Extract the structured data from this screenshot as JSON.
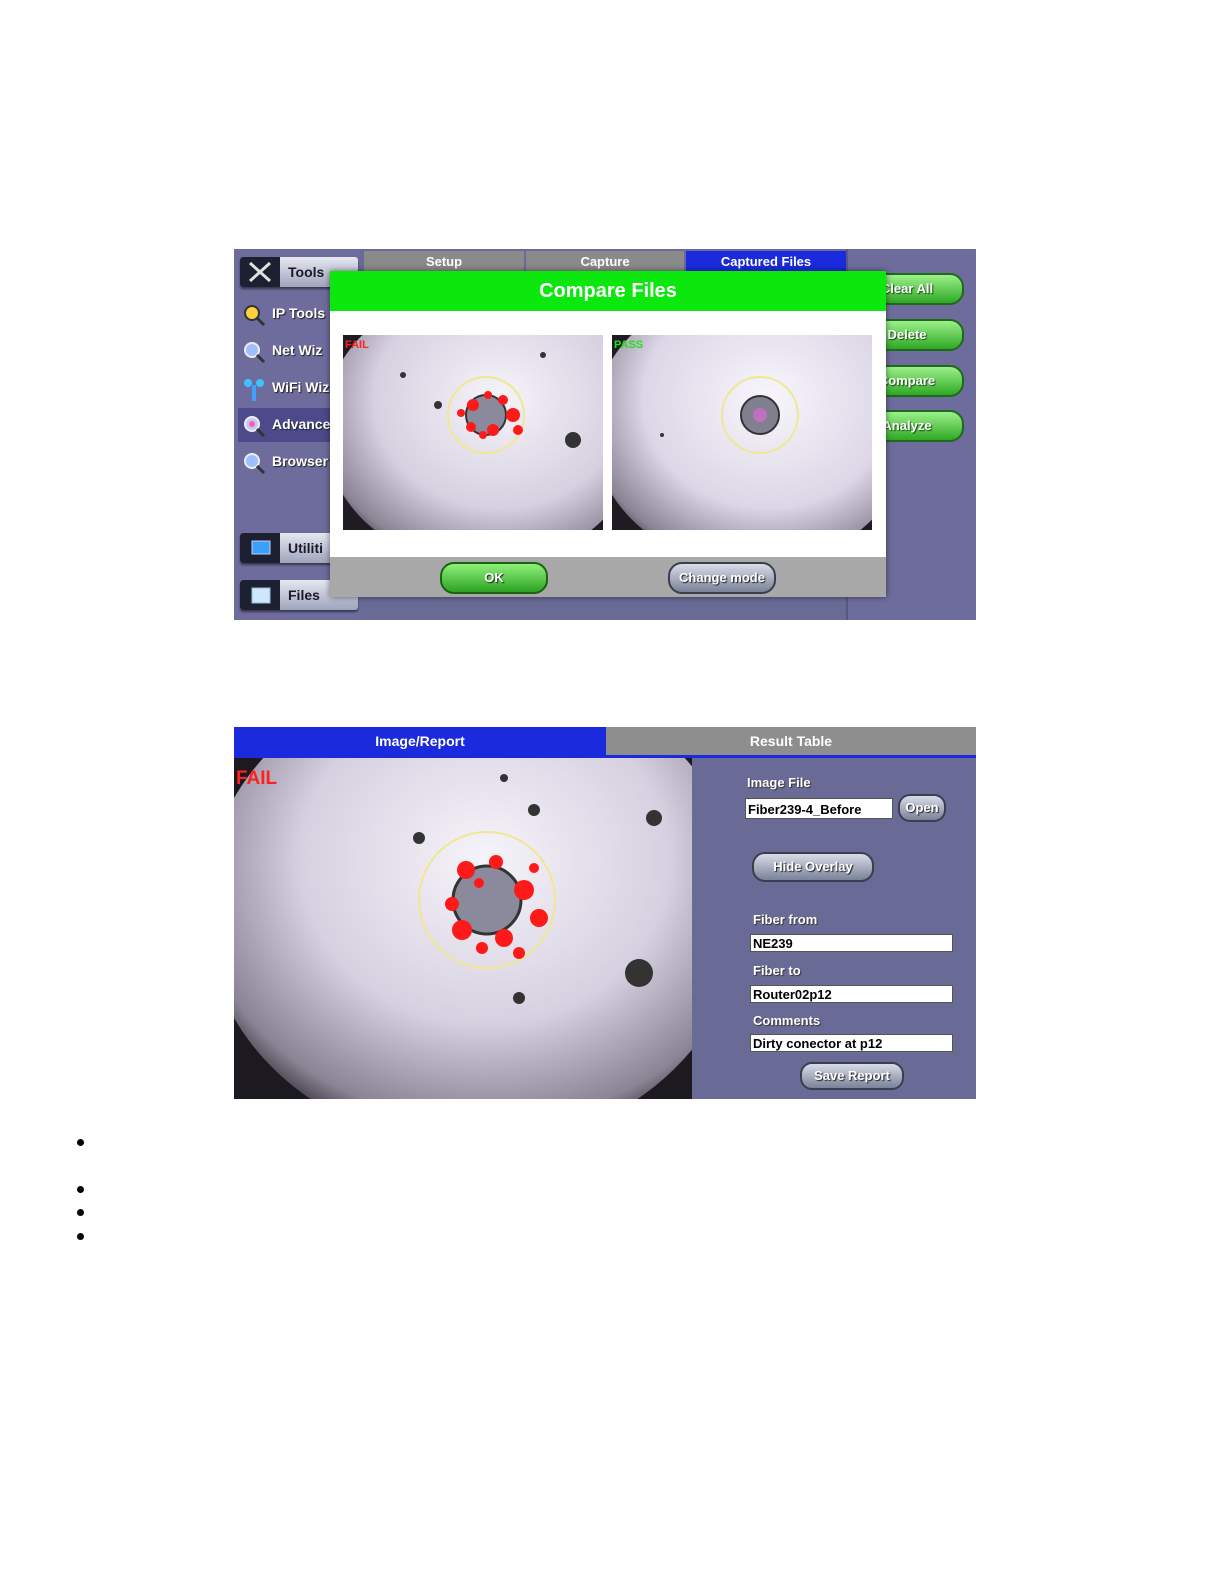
{
  "screen1": {
    "sidebar": {
      "tools_label": "Tools",
      "items": [
        {
          "label": "IP Tools",
          "icon": "magnifier-icon"
        },
        {
          "label": "Net Wiz",
          "icon": "network-magnifier-icon"
        },
        {
          "label": "WiFi Wiz",
          "icon": "wifi-antenna-icon"
        },
        {
          "label": "Advance",
          "icon": "advanced-magnifier-icon"
        },
        {
          "label": "Browser",
          "icon": "browser-magnifier-icon"
        }
      ],
      "utilities_label": "Utiliti",
      "files_label": "Files"
    },
    "tabs": [
      "Setup",
      "Capture",
      "Captured Files"
    ],
    "active_tab": "Captured Files",
    "right_buttons": [
      "Clear All",
      "Delete",
      "Compare",
      "Analyze"
    ],
    "dialog": {
      "title": "Compare Files",
      "left_status": "FAIL",
      "right_status": "PASS",
      "ok_label": "OK",
      "change_mode_label": "Change mode"
    }
  },
  "screen2": {
    "tabs": [
      "Image/Report",
      "Result Table"
    ],
    "active_tab": "Image/Report",
    "status": "FAIL",
    "image_file_label": "Image File",
    "image_file_value": "Fiber239-4_Before",
    "open_label": "Open",
    "hide_overlay_label": "Hide Overlay",
    "fiber_from_label": "Fiber from",
    "fiber_from_value": "NE239",
    "fiber_to_label": "Fiber to",
    "fiber_to_value": "Router02p12",
    "comments_label": "Comments",
    "comments_value": "Dirty conector at p12",
    "save_report_label": "Save Report"
  },
  "colors": {
    "dialog_title": "#0ce80e",
    "active_tab": "#1a2adc",
    "fail": "#ff2020",
    "pass": "#20e020",
    "panel": "#6a6a96"
  }
}
